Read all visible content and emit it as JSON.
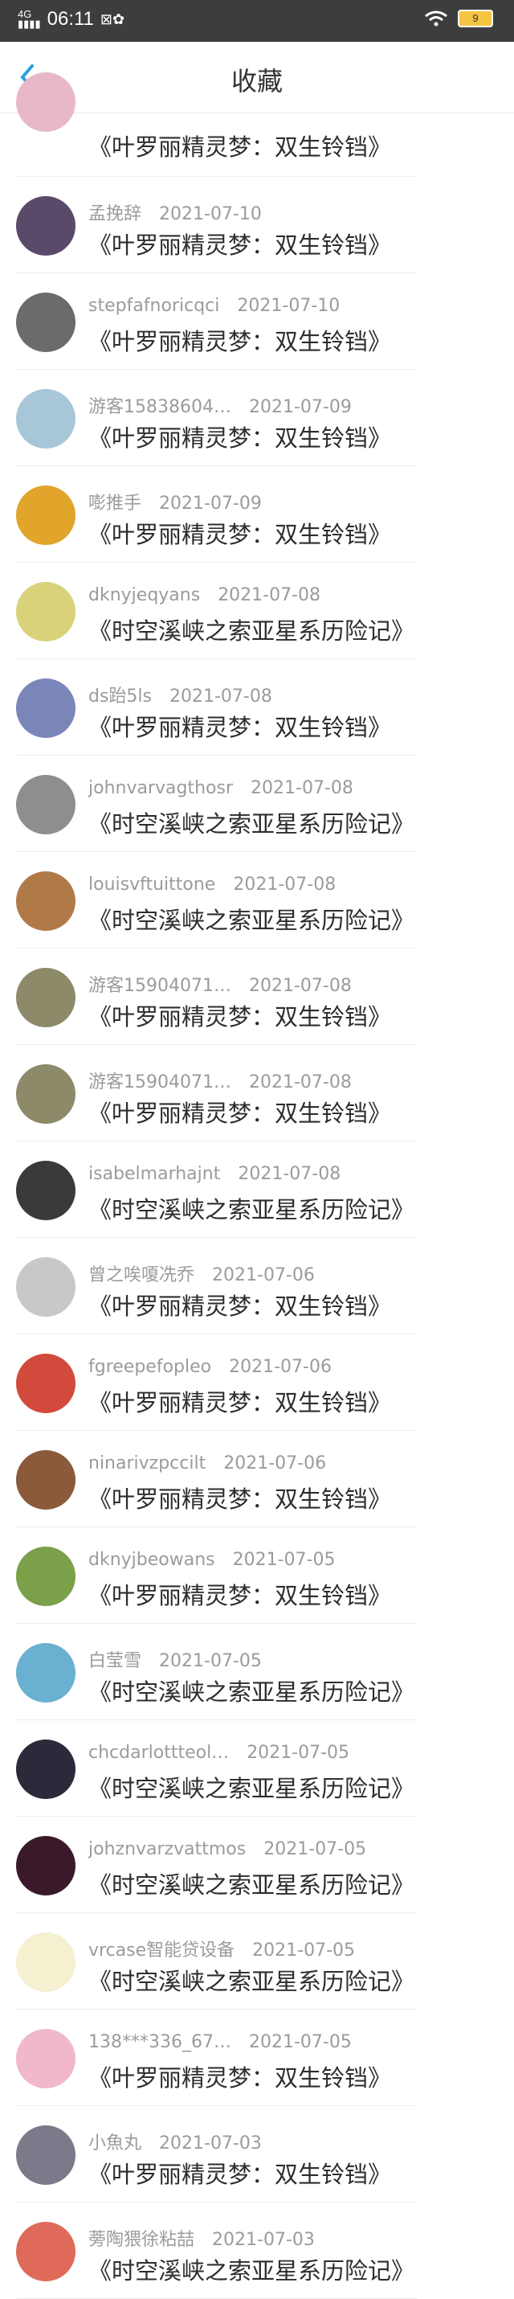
{
  "status_bar": {
    "time": "06:11",
    "network": "4G",
    "battery": "9"
  },
  "header": {
    "title": "收藏",
    "back_label": "<"
  },
  "first_partial_game": "《叶罗丽精灵梦：双生铃铛》",
  "items": [
    {
      "user": "孟挽辞",
      "date": "2021-07-10",
      "game": "《叶罗丽精灵梦：双生铃铛》",
      "avatar_color": "#5a4a6a"
    },
    {
      "user": "stepfafnoricqci",
      "date": "2021-07-10",
      "game": "《叶罗丽精灵梦：双生铃铛》",
      "avatar_color": "#6b6b6b"
    },
    {
      "user": "游客15838604…",
      "date": "2021-07-09",
      "game": "《叶罗丽精灵梦：双生铃铛》",
      "avatar_color": "#a7c7d8"
    },
    {
      "user": "嘭推手",
      "date": "2021-07-09",
      "game": "《叶罗丽精灵梦：双生铃铛》",
      "avatar_color": "#e0a52a"
    },
    {
      "user": "dknyjeqyans",
      "date": "2021-07-08",
      "game": "《时空溪峡之索亚星系历险记》",
      "avatar_color": "#d9d27a"
    },
    {
      "user": "ds跆5ls",
      "date": "2021-07-08",
      "game": "《叶罗丽精灵梦：双生铃铛》",
      "avatar_color": "#7b86b8"
    },
    {
      "user": "johnvarvagthosr",
      "date": "2021-07-08",
      "game": "《时空溪峡之索亚星系历险记》",
      "avatar_color": "#8e8e8e"
    },
    {
      "user": "louisvftuittone",
      "date": "2021-07-08",
      "game": "《时空溪峡之索亚星系历险记》",
      "avatar_color": "#b07a48"
    },
    {
      "user": "游客15904071…",
      "date": "2021-07-08",
      "game": "《叶罗丽精灵梦：双生铃铛》",
      "avatar_color": "#8d8a6a"
    },
    {
      "user": "游客15904071…",
      "date": "2021-07-08",
      "game": "《叶罗丽精灵梦：双生铃铛》",
      "avatar_color": "#8d8a6a"
    },
    {
      "user": "isabelmarhajnt",
      "date": "2021-07-08",
      "game": "《时空溪峡之索亚星系历险记》",
      "avatar_color": "#3a3a3a"
    },
    {
      "user": "曾之唉嗄冼乔",
      "date": "2021-07-06",
      "game": "《叶罗丽精灵梦：双生铃铛》",
      "avatar_color": "#c8c8c8"
    },
    {
      "user": "fgreepefopleo",
      "date": "2021-07-06",
      "game": "《叶罗丽精灵梦：双生铃铛》",
      "avatar_color": "#d24a3c"
    },
    {
      "user": "ninarivzpccilt",
      "date": "2021-07-06",
      "game": "《叶罗丽精灵梦：双生铃铛》",
      "avatar_color": "#8a5a3a"
    },
    {
      "user": "dknyjbeowans",
      "date": "2021-07-05",
      "game": "《叶罗丽精灵梦：双生铃铛》",
      "avatar_color": "#7aa04a"
    },
    {
      "user": "白莹雪",
      "date": "2021-07-05",
      "game": "《时空溪峡之索亚星系历险记》",
      "avatar_color": "#6ab0d0"
    },
    {
      "user": "chcdarlottteol…",
      "date": "2021-07-05",
      "game": "《时空溪峡之索亚星系历险记》",
      "avatar_color": "#2a2a3a"
    },
    {
      "user": "johznvarzvattmos",
      "date": "2021-07-05",
      "game": "《时空溪峡之索亚星系历险记》",
      "avatar_color": "#3a1a2a"
    },
    {
      "user": "vrcase智能贷设备",
      "date": "2021-07-05",
      "game": "《时空溪峡之索亚星系历险记》",
      "avatar_color": "#f4f0d0"
    },
    {
      "user": "138***336_67…",
      "date": "2021-07-05",
      "game": "《叶罗丽精灵梦：双生铃铛》",
      "avatar_color": "#f0b8c8"
    },
    {
      "user": "小魚丸",
      "date": "2021-07-03",
      "game": "《叶罗丽精灵梦：双生铃铛》",
      "avatar_color": "#7a7a8a"
    },
    {
      "user": "蒡陶猥徐粘喆",
      "date": "2021-07-03",
      "game": "《时空溪峡之索亚星系历险记》",
      "avatar_color": "#e06a5a"
    }
  ]
}
